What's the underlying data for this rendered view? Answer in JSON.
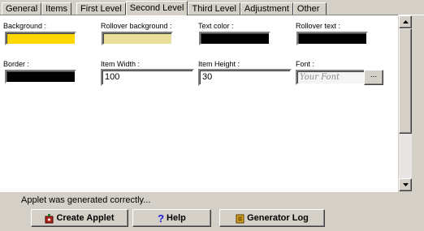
{
  "tabs": [
    "General",
    "Items",
    "First Level",
    "Second Level",
    "Third Level",
    "Adjustment",
    "Other"
  ],
  "active_tab": "Second Level",
  "fields": {
    "background": {
      "label": "Background :",
      "color": "#ffd700"
    },
    "rollover_background": {
      "label": "Rollover background :",
      "color": "#e8e09a"
    },
    "text_color": {
      "label": "Text color :",
      "color": "#000000"
    },
    "rollover_text": {
      "label": "Rollover text :",
      "color": "#000000"
    },
    "border": {
      "label": "Border :",
      "color": "#000000"
    },
    "item_width": {
      "label": "Item Width :",
      "value": "100"
    },
    "item_height": {
      "label": "Item Height :",
      "value": "30"
    },
    "font": {
      "label": "Font :",
      "value": "Your Font",
      "browse_label": "..."
    }
  },
  "status": "Applet was generated correctly...",
  "buttons": {
    "create_applet": "Create Applet",
    "help": "Help",
    "generator_log": "Generator Log"
  }
}
